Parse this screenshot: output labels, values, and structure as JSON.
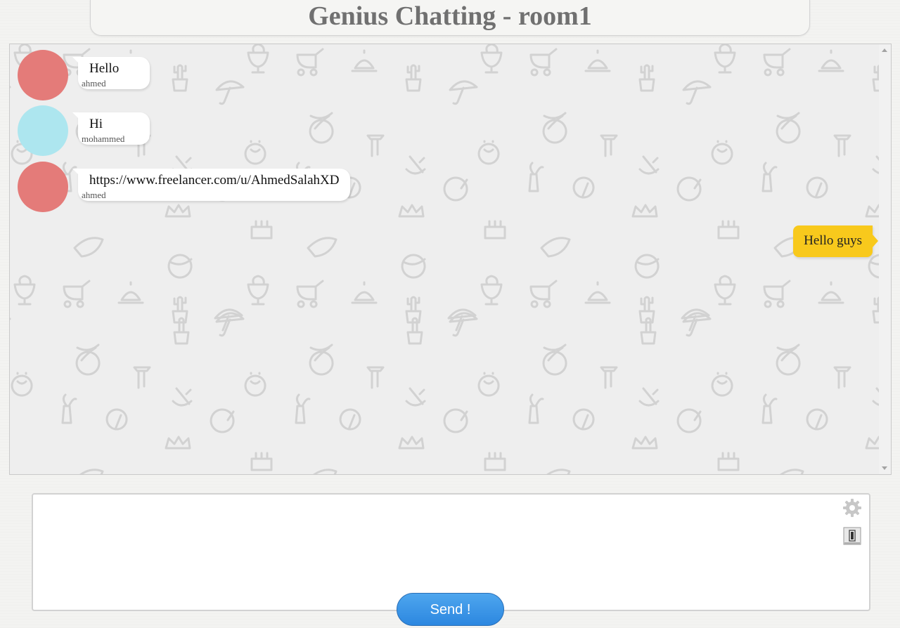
{
  "header": {
    "title": "Genius Chatting - room1"
  },
  "messages": [
    {
      "text": "Hello",
      "user": "ahmed",
      "avatar_color": "#e47b79"
    },
    {
      "text": "Hi",
      "user": "mohammed",
      "avatar_color": "#ade6ef"
    },
    {
      "text": "https://www.freelancer.com/u/AhmedSalahXD",
      "user": "ahmed",
      "avatar_color": "#e47b79"
    }
  ],
  "own_message": {
    "text": "Hello guys",
    "color": "#f8c91c"
  },
  "composer": {
    "value": "",
    "settings_icon": "gear-icon",
    "switch_icon": "switch-icon"
  },
  "send_button": {
    "label": "Send !",
    "color": "#3596e6"
  },
  "colors": {
    "chat_background": "#eeeeee",
    "pattern": "#d4d4d4"
  }
}
